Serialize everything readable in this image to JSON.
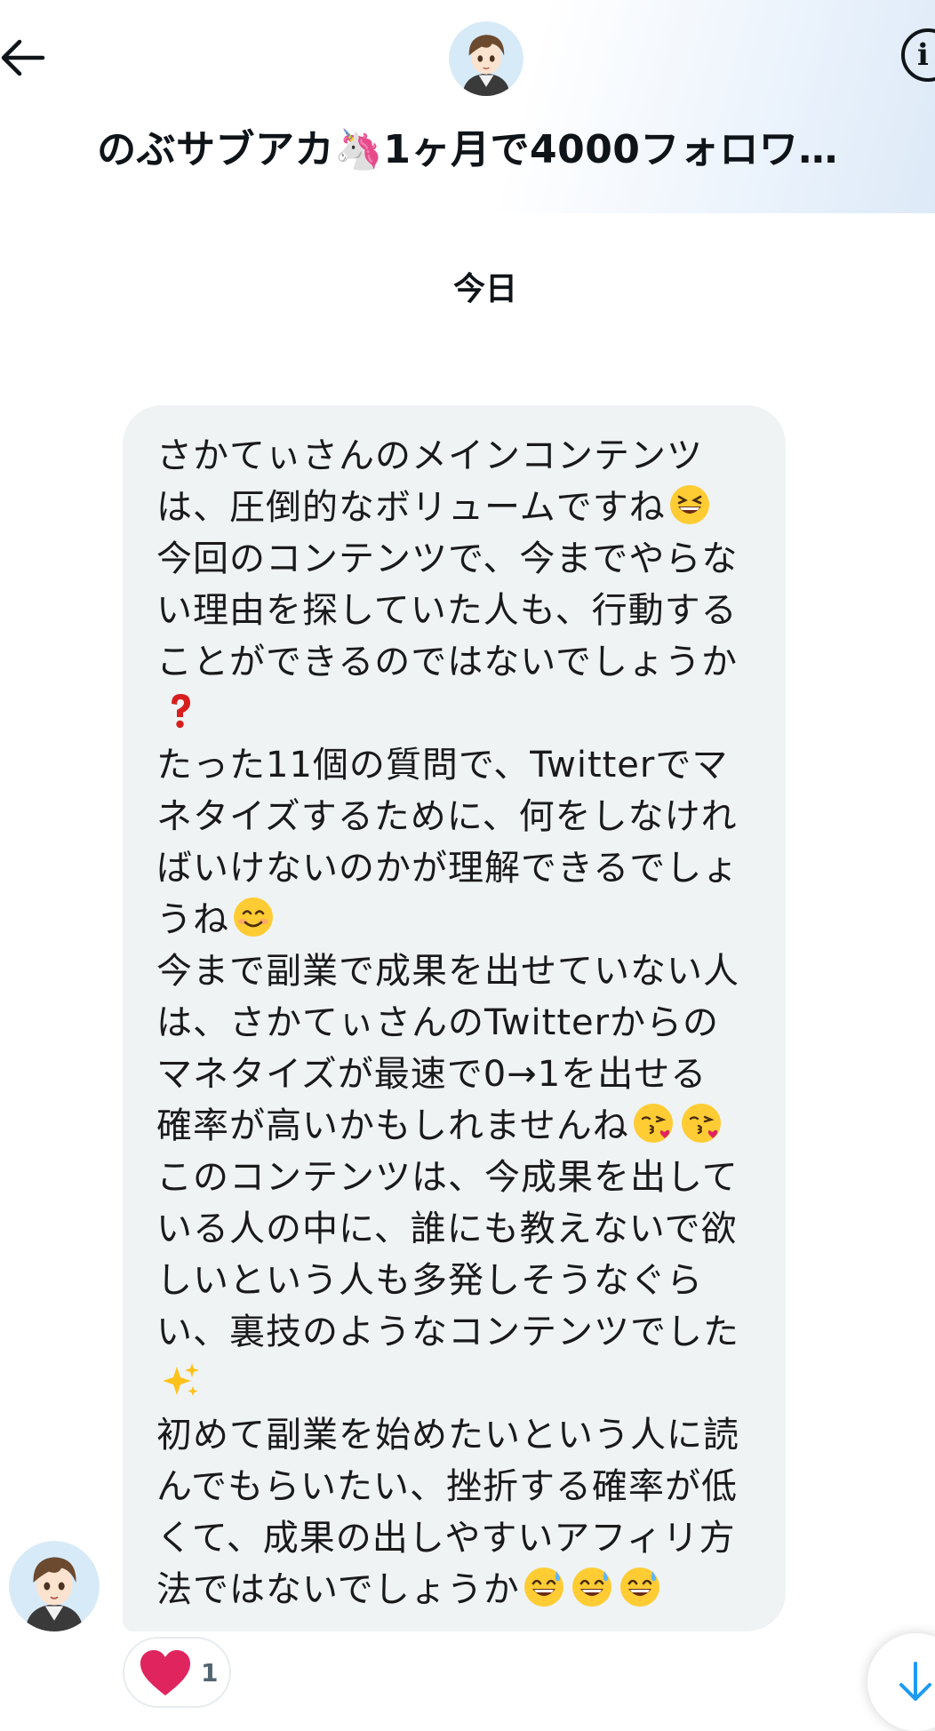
{
  "header": {
    "title": "のぶサブアカ🦄1ヶ月で4000フォロワ…",
    "back_icon": "arrow-left-icon",
    "info_icon": "info-icon",
    "info_glyph": "i"
  },
  "conversation": {
    "date_separator": "今日",
    "message": {
      "lines": [
        "さかてぃさんのメインコンテンツ",
        "は、圧倒的なボリュームですね",
        "今回のコンテンツで、今までやらな",
        "い理由を探していた人も、行動する",
        "ことができるのではないでしょうか",
        "",
        "たった11個の質問で、Twitterでマ",
        "ネタイズするために、何をしなけれ",
        "ばいけないのかが理解できるでしょ",
        "うね",
        "今まで副業で成果を出せていない人",
        "は、さかてぃさんのTwitterからの",
        "マネタイズが最速で0→1を出せる",
        "確率が高いかもしれませんね",
        "このコンテンツは、今成果を出して",
        "いる人の中に、誰にも教えないで欲",
        "しいという人も多発しそうなぐら",
        "い、裏技のようなコンテンツでした",
        "",
        "初めて副業を始めたいという人に読",
        "んでもらいたい、挫折する確率が低",
        "くて、成果の出しやすいアフィリ方",
        "法ではないでしょうか"
      ],
      "emojis": {
        "grinning_squint": "grinning-squinting-face-emoji",
        "question": "red-question-mark-emoji",
        "smiling": "smiling-face-emoji",
        "kissing_heart": "face-blowing-kiss-emoji",
        "sparkles": "sparkles-emoji",
        "sweat_smile": "grinning-face-with-sweat-emoji"
      }
    },
    "reaction": {
      "icon": "heart-icon",
      "count": "1",
      "color": "#e0245e"
    },
    "scroll_down_icon": "arrow-down-icon"
  },
  "colors": {
    "bubble": "#eff3f4",
    "accent": "#1d9bf0",
    "text": "#0f1419"
  }
}
